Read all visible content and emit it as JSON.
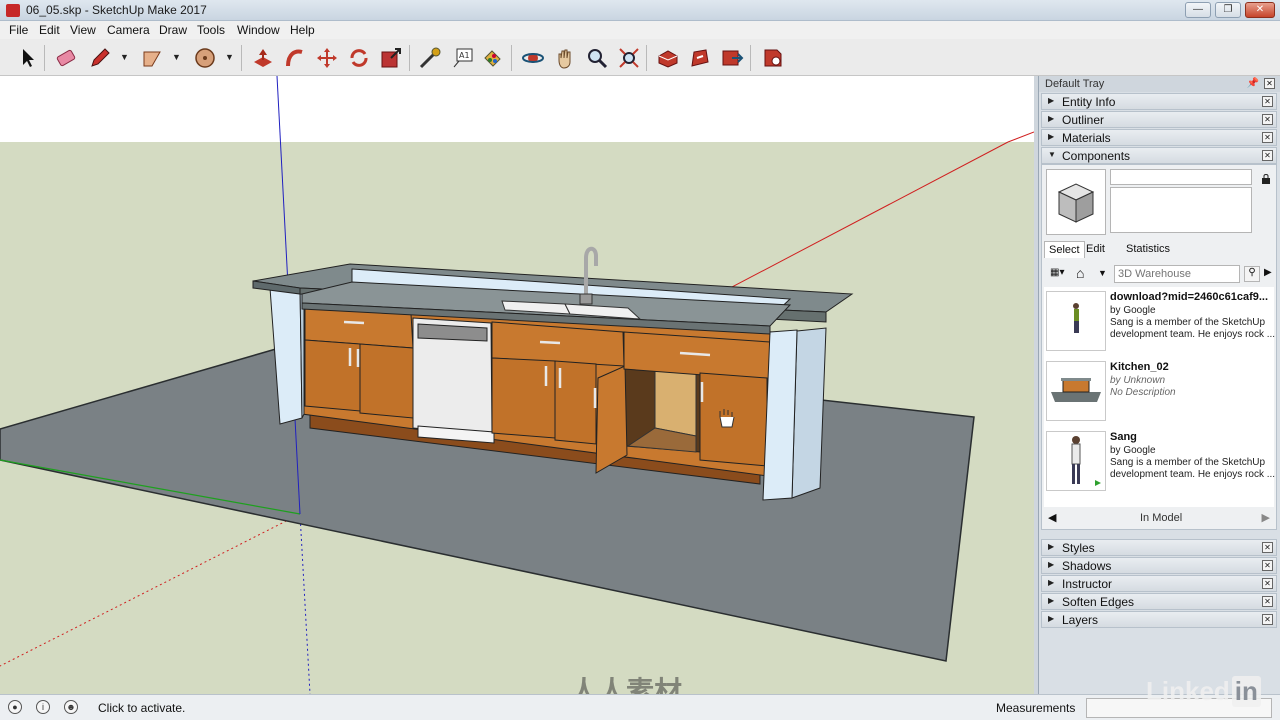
{
  "window": {
    "title": "06_05.skp - SketchUp Make 2017",
    "controls": [
      "minimize",
      "maximize",
      "close"
    ]
  },
  "menu": [
    "File",
    "Edit",
    "View",
    "Camera",
    "Draw",
    "Tools",
    "Window",
    "Help"
  ],
  "toolbar": {
    "tools": [
      "select-icon",
      "eraser-icon",
      "pencil-icon",
      "arc-icon",
      "shape-icon",
      "push-pull-icon",
      "follow-me-icon",
      "move-icon",
      "rotate-icon",
      "scale-icon",
      "tape-measure-icon",
      "text-icon",
      "paint-bucket-icon",
      "orbit-icon",
      "pan-icon",
      "zoom-icon",
      "zoom-extents-icon",
      "3d-warehouse-icon",
      "extension-warehouse-icon",
      "share-model-icon",
      "extension-icon"
    ]
  },
  "tray": {
    "title": "Default Tray",
    "panels_top": [
      "Entity Info",
      "Outliner",
      "Materials",
      "Components"
    ],
    "components": {
      "tabs": [
        "Select",
        "Edit",
        "Statistics"
      ],
      "search_placeholder": "3D Warehouse",
      "results": [
        {
          "title": "download?mid=2460c61caf9...",
          "author": "by Google",
          "desc": "Sang is a member of the SketchUp development team. He enjoys rock ...",
          "author_italic": false
        },
        {
          "title": "Kitchen_02",
          "author": "by Unknown",
          "desc": "No Description",
          "author_italic": true
        },
        {
          "title": "Sang",
          "author": "by Google",
          "desc": "Sang is a member of the SketchUp development team. He enjoys rock ...",
          "author_italic": false
        }
      ],
      "nav_label": "In Model"
    },
    "panels_bottom": [
      "Styles",
      "Shadows",
      "Instructor",
      "Soften Edges",
      "Layers"
    ]
  },
  "status": {
    "message": "Click to activate.",
    "measurements_label": "Measurements"
  },
  "watermark": {
    "logo_text": "人人素材",
    "brand": "Linked",
    "brand_in": "in"
  },
  "colors": {
    "sky": "#ffffff",
    "ground": "#d4dbc2",
    "floor_slab": "#7a8185",
    "cabinet_wood": "#c8792f",
    "countertop": "#7f8a8c",
    "end_panel": "#dcecf8",
    "axis_red": "#d02020",
    "axis_green": "#1ea01e",
    "axis_blue": "#2020c0"
  }
}
